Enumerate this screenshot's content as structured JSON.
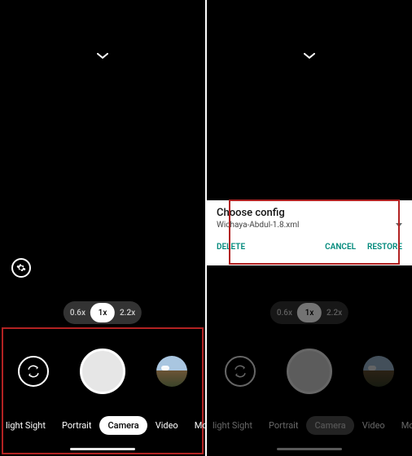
{
  "zoom": {
    "options": [
      "0.6x",
      "1x",
      "2.2x"
    ],
    "active_index": 1
  },
  "modes": {
    "items": [
      "Night Sight",
      "Portrait",
      "Camera",
      "Video",
      "More"
    ],
    "visible_left_label": "light Sight",
    "active_index": 2
  },
  "dialog": {
    "title": "Choose config",
    "filename": "Wichaya-Abdul-1.8.xml",
    "delete": "DELETE",
    "cancel": "CANCEL",
    "restore": "RESTORE"
  },
  "colors": {
    "accent_red": "#b22222",
    "accent_teal": "#00897b"
  }
}
